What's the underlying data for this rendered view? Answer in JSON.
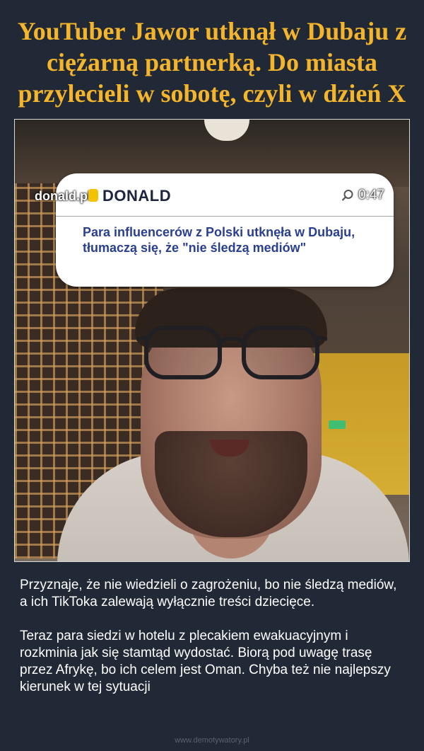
{
  "title": "YouTuber Jawor utknął w Dubaju z ciężarną partnerką. Do miasta przylecieli w sobotę, czyli w dzień X",
  "photo": {
    "overlay": {
      "site_domain": "donald.pl",
      "site_brand": "DONALD",
      "timer": "0:47",
      "headline": "Para influencerów z Polski utknęła w Dubaju, tłumaczą się, że \"nie śledzą mediów\"",
      "search_icon": "search-icon",
      "brand_color": "#2a3f92"
    }
  },
  "caption": {
    "paragraph_1": "Przyznaje, że nie wiedzieli o zagrożeniu, bo nie śledzą mediów, a ich TikToka zalewają wyłącznie treści dziecięce.",
    "paragraph_2": "Teraz para siedzi w hotelu z plecakiem ewakuacyjnym i rozkminia jak się stamtąd wydostać. Biorą pod uwagę trasę przez Afrykę, bo ich celem jest Oman. Chyba też nie najlepszy kierunek w tej sytuacji"
  },
  "watermark": "www.demotywatory.pl",
  "colors": {
    "background": "#212836",
    "title": "#f4b52c",
    "caption": "#ffffff"
  }
}
